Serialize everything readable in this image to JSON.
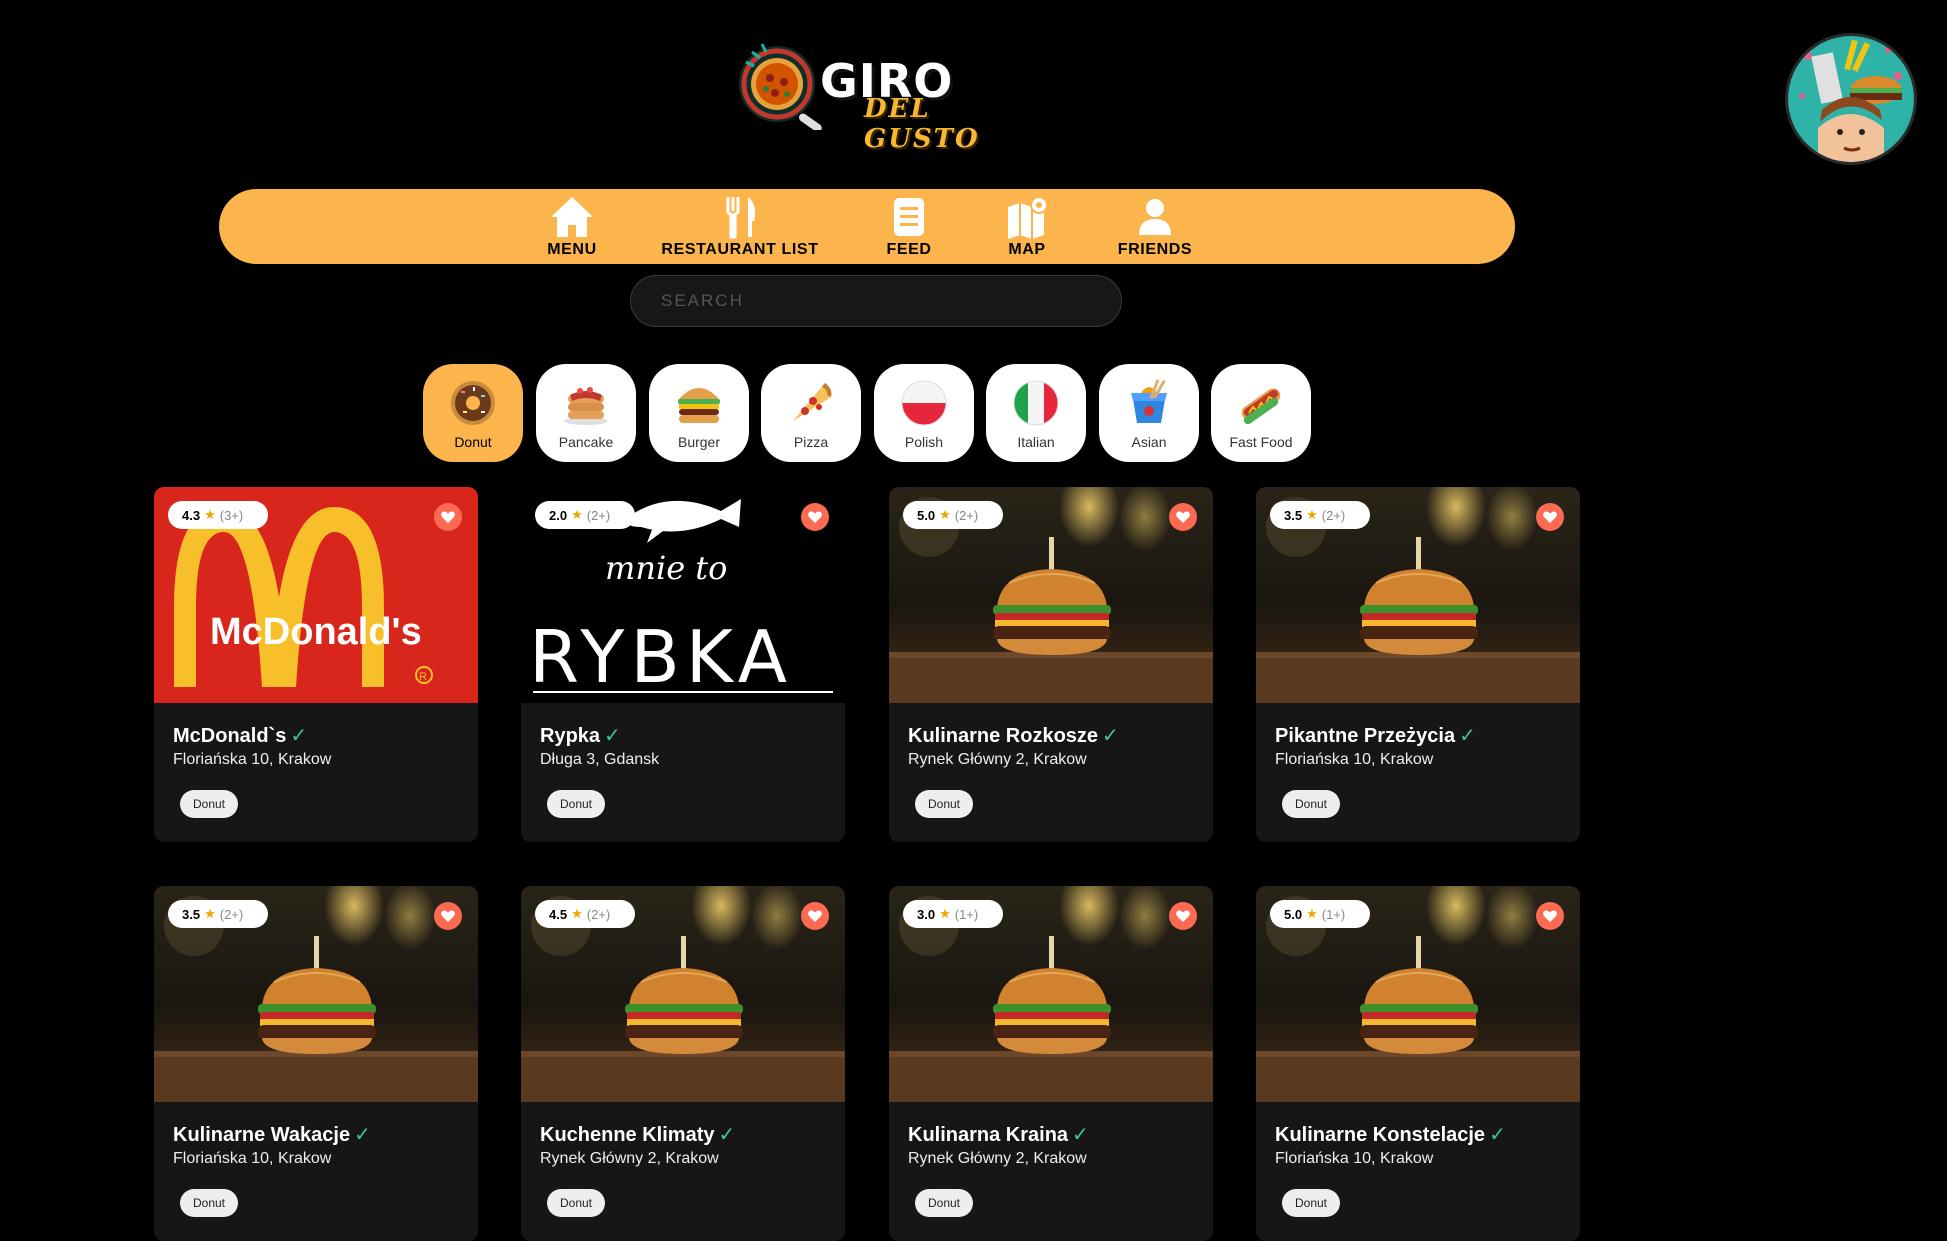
{
  "header": {
    "logo_giro": "GIRO",
    "logo_del": "DEL GUSTO"
  },
  "nav": {
    "items": [
      {
        "label": "MENU",
        "icon": "home-icon"
      },
      {
        "label": "RESTAURANT LIST",
        "icon": "fork-knife-icon"
      },
      {
        "label": "FEED",
        "icon": "document-icon"
      },
      {
        "label": "MAP",
        "icon": "map-icon"
      },
      {
        "label": "FRIENDS",
        "icon": "person-icon"
      }
    ]
  },
  "search": {
    "placeholder": "SEARCH",
    "value": ""
  },
  "categories": [
    {
      "label": "Donut",
      "icon": "donut-icon",
      "active": true
    },
    {
      "label": "Pancake",
      "icon": "pancake-icon"
    },
    {
      "label": "Burger",
      "icon": "burger-icon"
    },
    {
      "label": "Pizza",
      "icon": "pizza-icon"
    },
    {
      "label": "Polish",
      "icon": "polish-flag-icon"
    },
    {
      "label": "Italian",
      "icon": "italian-flag-icon"
    },
    {
      "label": "Asian",
      "icon": "takeout-box-icon"
    },
    {
      "label": "Fast Food",
      "icon": "hotdog-icon"
    }
  ],
  "restaurants": [
    {
      "name": "McDonald`s",
      "address": "Floriańska 10, Krakow",
      "rating": "4.3",
      "count": "(3+)",
      "tag": "Donut",
      "image": "mcdonalds-logo"
    },
    {
      "name": "Rypka",
      "address": "Długa 3, Gdansk",
      "rating": "2.0",
      "count": "(2+)",
      "tag": "Donut",
      "image": "rybka-logo"
    },
    {
      "name": "Kulinarne Rozkosze",
      "address": "Rynek Główny 2, Krakow",
      "rating": "5.0",
      "count": "(2+)",
      "tag": "Donut",
      "image": "burger-photo"
    },
    {
      "name": "Pikantne Przeżycia",
      "address": "Floriańska 10, Krakow",
      "rating": "3.5",
      "count": "(2+)",
      "tag": "Donut",
      "image": "burger-photo"
    },
    {
      "name": "Kulinarne Wakacje",
      "address": "Floriańska 10, Krakow",
      "rating": "3.5",
      "count": "(2+)",
      "tag": "Donut",
      "image": "burger-photo"
    },
    {
      "name": "Kuchenne Klimaty",
      "address": "Rynek Główny 2, Krakow",
      "rating": "4.5",
      "count": "(2+)",
      "tag": "Donut",
      "image": "burger-photo"
    },
    {
      "name": "Kulinarna Kraina",
      "address": "Rynek Główny 2, Krakow",
      "rating": "3.0",
      "count": "(1+)",
      "tag": "Donut",
      "image": "burger-photo"
    },
    {
      "name": "Kulinarne Konstelacje",
      "address": "Floriańska 10, Krakow",
      "rating": "5.0",
      "count": "(1+)",
      "tag": "Donut",
      "image": "burger-photo"
    }
  ],
  "rybka_logo": {
    "line1": "mnie to",
    "line2": "RYBKA"
  },
  "mcdonalds_logo": {
    "wordmark": "McDonald's"
  },
  "colors": {
    "accent": "#fbb54c",
    "favorite": "#fb6a52",
    "verified": "#38c98c",
    "card": "#161616"
  }
}
